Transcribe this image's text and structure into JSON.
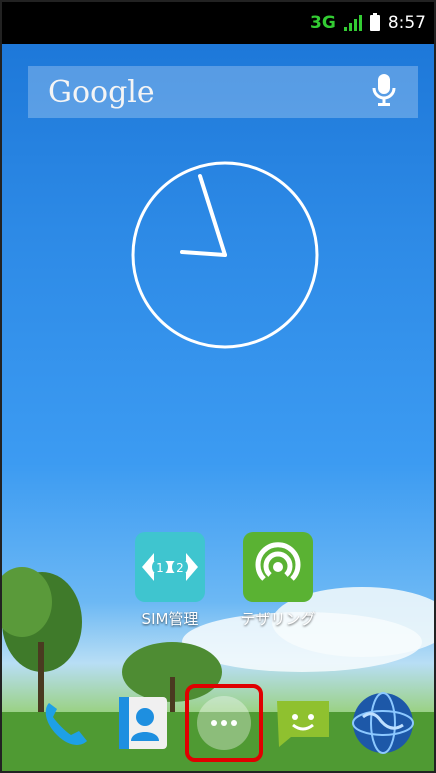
{
  "status_bar": {
    "network": "3G",
    "time": "8:57"
  },
  "search_bar": {
    "logo_text": "Google"
  },
  "home_apps": [
    {
      "label": "SIM管理",
      "icon": "sim-management-icon"
    },
    {
      "label": "テザリング",
      "icon": "tethering-icon"
    }
  ],
  "dock": [
    {
      "icon": "phone-icon"
    },
    {
      "icon": "contacts-icon"
    },
    {
      "icon": "app-drawer-icon"
    },
    {
      "icon": "messaging-icon"
    },
    {
      "icon": "browser-globe-icon"
    }
  ],
  "colors": {
    "network_green": "#33cc33",
    "highlight_red": "#e00000",
    "sim_teal": "#3fc5cf",
    "tether_green": "#5ab233"
  }
}
